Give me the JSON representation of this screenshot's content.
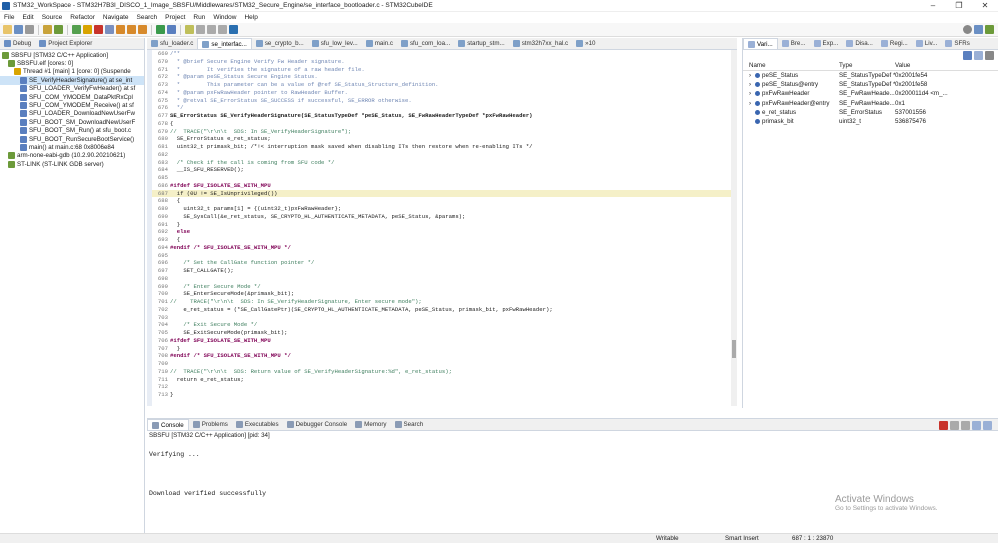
{
  "window": {
    "title": "STM32_WorkSpace - STM32H7B3I_DISCO_1_Image_SBSFU/Middlewares/STM32_Secure_Engine/se_interface_bootloader.c - STM32CubeIDE"
  },
  "menu": [
    "File",
    "Edit",
    "Source",
    "Refactor",
    "Navigate",
    "Search",
    "Project",
    "Run",
    "Window",
    "Help"
  ],
  "left_tabs": [
    {
      "label": "Debug"
    },
    {
      "label": "Project Explorer"
    }
  ],
  "debug_tree": [
    {
      "label": "SBSFU [STM32 C/C++ Application]",
      "indent": 0
    },
    {
      "label": "SBSFU.elf [cores: 0]",
      "indent": 1
    },
    {
      "label": "Thread #1 [main] 1 [core: 0] (Suspende",
      "indent": 2
    },
    {
      "label": "SE_VerifyHeaderSignature() at se_int",
      "indent": 3,
      "selected": true
    },
    {
      "label": "SFU_LOADER_VerifyFwHeader() at sf",
      "indent": 3
    },
    {
      "label": "SFU_COM_YMODEM_DataPktRxCpl",
      "indent": 3
    },
    {
      "label": "SFU_COM_YMODEM_Receive() at sf",
      "indent": 3
    },
    {
      "label": "SFU_LOADER_DownloadNewUserFw",
      "indent": 3
    },
    {
      "label": "SFU_BOOT_SM_DownloadNewUserF",
      "indent": 3
    },
    {
      "label": "SFU_BOOT_SM_Run() at sfu_boot.c",
      "indent": 3
    },
    {
      "label": "SFU_BOOT_RunSecureBootService()",
      "indent": 3
    },
    {
      "label": "main() at main.c:68 0x8006e84",
      "indent": 3
    },
    {
      "label": "arm-none-eabi-gdb (10.2.90.20210621)",
      "indent": 1
    },
    {
      "label": "ST-LINK (ST-LINK GDB server)",
      "indent": 1
    }
  ],
  "editor_tabs": [
    {
      "label": "sfu_loader.c"
    },
    {
      "label": "se_interfac...",
      "active": true
    },
    {
      "label": "se_crypto_b..."
    },
    {
      "label": "sfu_low_lev..."
    },
    {
      "label": "main.c"
    },
    {
      "label": "sfu_com_loa..."
    },
    {
      "label": "startup_stm..."
    },
    {
      "label": "stm32h7xx_hal.c"
    },
    {
      "label": "»10"
    }
  ],
  "code": [
    {
      "n": "669",
      "t": "/**",
      "c": "dc"
    },
    {
      "n": "670",
      "t": "  * @brief Secure Engine Verify Fw Header signature.",
      "c": "dc"
    },
    {
      "n": "671",
      "t": "  *        It verifies the signature of a raw header file.",
      "c": "dc"
    },
    {
      "n": "672",
      "t": "  * @param peSE_Status Secure Engine Status.",
      "c": "dc"
    },
    {
      "n": "673",
      "t": "  *        This parameter can be a value of @ref SE_Status_Structure_definition.",
      "c": "dc"
    },
    {
      "n": "674",
      "t": "  * @param pxFwRawHeader pointer to RawHeader Buffer.",
      "c": "dc"
    },
    {
      "n": "675",
      "t": "  * @retval SE_ErrorStatus SE_SUCCESS if successful, SE_ERROR otherwise.",
      "c": "dc"
    },
    {
      "n": "676",
      "t": "  */",
      "c": "dc"
    },
    {
      "n": "677",
      "t": "SE_ErrorStatus SE_VerifyHeaderSignature(SE_StatusTypeDef *peSE_Status, SE_FwRawHeaderTypeDef *pxFwRawHeader)",
      "c": "fn"
    },
    {
      "n": "678",
      "t": "{",
      "c": ""
    },
    {
      "n": "679",
      "t": "//  TRACE(\"\\r\\n\\t  SDS: In SE_VerifyHeaderSignature\");",
      "c": "cm"
    },
    {
      "n": "680",
      "t": "  SE_ErrorStatus e_ret_status;",
      "c": ""
    },
    {
      "n": "681",
      "t": "  uint32_t primask_bit; /*!< interruption mask saved when disabling ITs then restore when re-enabling ITs */",
      "c": ""
    },
    {
      "n": "682",
      "t": "",
      "c": ""
    },
    {
      "n": "683",
      "t": "  /* Check if the call is coming from SFU code */",
      "c": "cm"
    },
    {
      "n": "684",
      "t": "  __IS_SFU_RESERVED();",
      "c": ""
    },
    {
      "n": "685",
      "t": "",
      "c": ""
    },
    {
      "n": "686",
      "t": "#ifdef SFU_ISOLATE_SE_WITH_MPU",
      "c": "kw"
    },
    {
      "n": "687",
      "t": "  if (0U != SE_IsUnprivileged())",
      "c": "",
      "hl": true
    },
    {
      "n": "688",
      "t": "  {",
      "c": ""
    },
    {
      "n": "689",
      "t": "    uint32_t params[1] = {(uint32_t)pxFwRawHeader};",
      "c": ""
    },
    {
      "n": "690",
      "t": "    SE_SysCall(&e_ret_status, SE_CRYPTO_HL_AUTHENTICATE_METADATA, peSE_Status, &params);",
      "c": ""
    },
    {
      "n": "691",
      "t": "  }",
      "c": ""
    },
    {
      "n": "692",
      "t": "  else",
      "c": "kw"
    },
    {
      "n": "693",
      "t": "  {",
      "c": ""
    },
    {
      "n": "694",
      "t": "#endif /* SFU_ISOLATE_SE_WITH_MPU */",
      "c": "kw"
    },
    {
      "n": "695",
      "t": "",
      "c": ""
    },
    {
      "n": "696",
      "t": "    /* Set the CallGate function pointer */",
      "c": "cm"
    },
    {
      "n": "697",
      "t": "    SET_CALLGATE();",
      "c": ""
    },
    {
      "n": "698",
      "t": "",
      "c": ""
    },
    {
      "n": "699",
      "t": "    /* Enter Secure Mode */",
      "c": "cm"
    },
    {
      "n": "700",
      "t": "    SE_EnterSecureMode(&primask_bit);",
      "c": ""
    },
    {
      "n": "701",
      "t": "//    TRACE(\"\\r\\n\\t  SDS: In SE_VerifyHeaderSignature, Enter secure mode\");",
      "c": "cm"
    },
    {
      "n": "702",
      "t": "    e_ret_status = (*SE_CallGatePtr)(SE_CRYPTO_HL_AUTHENTICATE_METADATA, peSE_Status, primask_bit, pxFwRawHeader);",
      "c": ""
    },
    {
      "n": "703",
      "t": "",
      "c": ""
    },
    {
      "n": "704",
      "t": "    /* Exit Secure Mode */",
      "c": "cm"
    },
    {
      "n": "705",
      "t": "    SE_ExitSecureMode(primask_bit);",
      "c": ""
    },
    {
      "n": "706",
      "t": "#ifdef SFU_ISOLATE_SE_WITH_MPU",
      "c": "kw"
    },
    {
      "n": "707",
      "t": "  }",
      "c": ""
    },
    {
      "n": "708",
      "t": "#endif /* SFU_ISOLATE_SE_WITH_MPU */",
      "c": "kw"
    },
    {
      "n": "709",
      "t": "",
      "c": ""
    },
    {
      "n": "710",
      "t": "//  TRACE(\"\\r\\n\\t  SDS: Return value of SE_VerifyHeaderSignature:%d\", e_ret_status);",
      "c": "cm"
    },
    {
      "n": "711",
      "t": "  return e_ret_status;",
      "c": ""
    },
    {
      "n": "712",
      "t": "",
      "c": ""
    },
    {
      "n": "713",
      "t": "}",
      "c": ""
    }
  ],
  "var_tabs": [
    {
      "label": "Vari...",
      "active": true
    },
    {
      "label": "Bre..."
    },
    {
      "label": "Exp..."
    },
    {
      "label": "Disa..."
    },
    {
      "label": "Regi..."
    },
    {
      "label": "Liv..."
    },
    {
      "label": "SFRs"
    }
  ],
  "var_headers": {
    "name": "Name",
    "type": "Type",
    "value": "Value"
  },
  "variables": [
    {
      "name": "peSE_Status",
      "type": "SE_StatusTypeDef *",
      "value": "0x2001fe54",
      "exp": true
    },
    {
      "name": "peSE_Status@entry",
      "type": "SE_StatusTypeDef *",
      "value": "0x2001fe58",
      "exp": true
    },
    {
      "name": "pxFwRawHeader",
      "type": "SE_FwRawHeade...",
      "value": "0x200011d4 <m_...",
      "exp": true
    },
    {
      "name": "pxFwRawHeader@entry",
      "type": "SE_FwRawHeade...",
      "value": "0x1",
      "exp": true
    },
    {
      "name": "e_ret_status",
      "type": "SE_ErrorStatus",
      "value": "537001556",
      "exp": false
    },
    {
      "name": "primask_bit",
      "type": "uint32_t",
      "value": "536875476",
      "exp": false
    }
  ],
  "bottom_tabs": [
    {
      "label": "Console",
      "active": true
    },
    {
      "label": "Problems"
    },
    {
      "label": "Executables"
    },
    {
      "label": "Debugger Console"
    },
    {
      "label": "Memory"
    },
    {
      "label": "Search"
    }
  ],
  "console": {
    "header": "SBSFU [STM32 C/C++ Application] [pid: 34]",
    "lines": [
      "Verifying ...",
      "Download verified successfully"
    ]
  },
  "watermark": {
    "line1": "Activate Windows",
    "line2": "Go to Settings to activate Windows."
  },
  "status": {
    "writable": "Writable",
    "insert": "Smart Insert",
    "position": "687 : 1 : 23870"
  },
  "colors": {
    "accent": "#1f5fa8",
    "selection": "#cde3f7",
    "highlight_line": "#f5f0c8"
  }
}
